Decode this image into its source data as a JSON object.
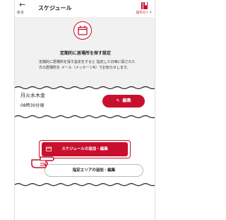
{
  "header": {
    "back_arrow": "←",
    "back_label": "戻る",
    "title": "スケジュール",
    "guide_label": "操作ガイド"
  },
  "info": {
    "title": "定期的に居場所を探す設定",
    "description": "定期的に居場所を探す設定をすると 指定した日時に探された方の居場所を メール（メッセージR）でお知らせします。"
  },
  "schedule": {
    "days": "月火水木金",
    "time": "08時30分頃",
    "edit_label": "編集",
    "edit_icon": "pencil-icon"
  },
  "actions": {
    "add_label": "スケジュールの追加・編集",
    "area_label": "指定エリアの追加・編集"
  },
  "colors": {
    "accent": "#c8102e",
    "panel": "#f1f1f1"
  }
}
